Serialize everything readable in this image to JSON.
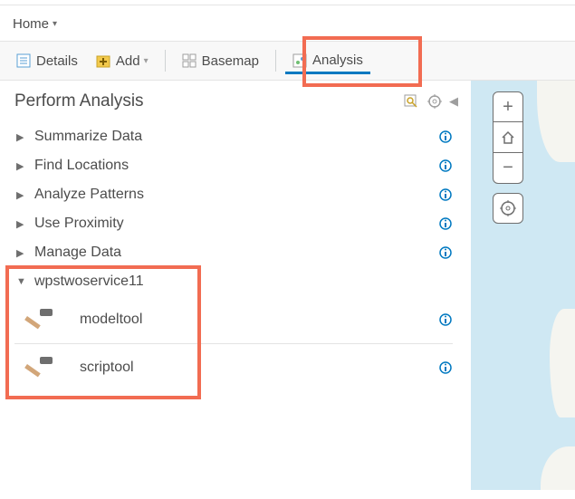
{
  "nav": {
    "home": "Home"
  },
  "toolbar": {
    "details": "Details",
    "add": "Add",
    "basemap": "Basemap",
    "analysis": "Analysis"
  },
  "panel": {
    "title": "Perform Analysis",
    "categories": [
      {
        "label": "Summarize Data",
        "expanded": false
      },
      {
        "label": "Find Locations",
        "expanded": false
      },
      {
        "label": "Analyze Patterns",
        "expanded": false
      },
      {
        "label": "Use Proximity",
        "expanded": false
      },
      {
        "label": "Manage Data",
        "expanded": false
      },
      {
        "label": "wpstwoservice11",
        "expanded": true
      }
    ],
    "tools": [
      {
        "label": "modeltool"
      },
      {
        "label": "scriptool"
      }
    ]
  }
}
